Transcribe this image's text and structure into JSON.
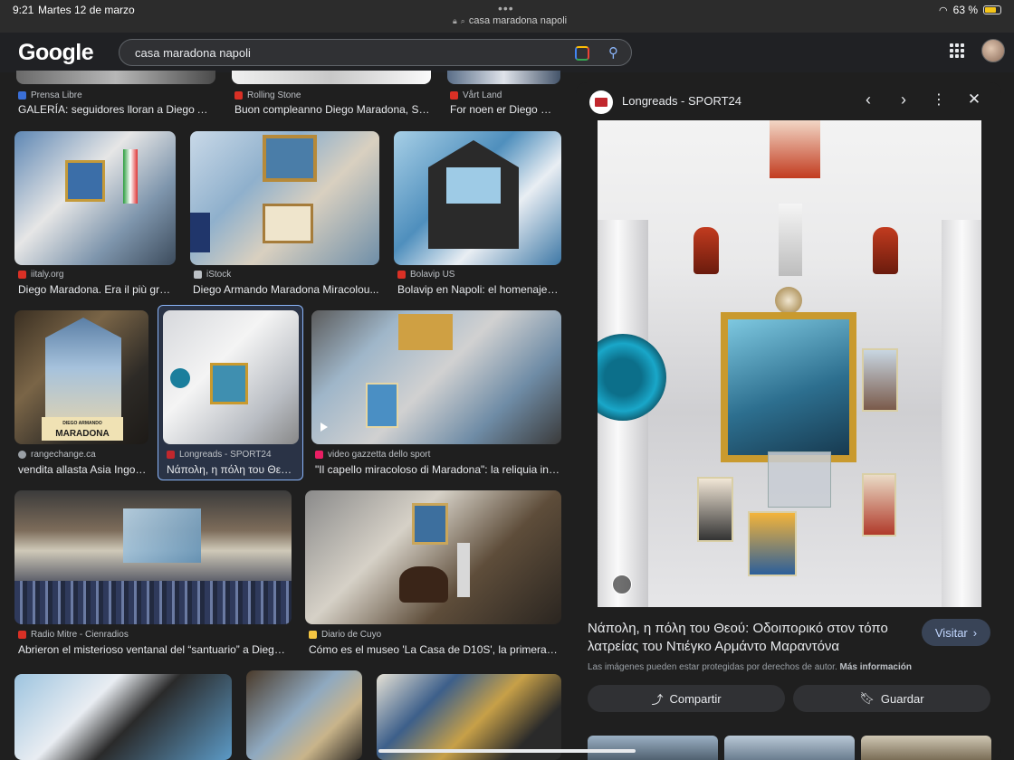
{
  "status_bar": {
    "time": "9:21",
    "date": "Martes 12 de marzo",
    "dots": "•••",
    "url": "casa maradona napoli",
    "battery": "63 %"
  },
  "header": {
    "logo": "Google",
    "search_value": "casa maradona napoli"
  },
  "results": [
    {
      "source": "Prensa Libre",
      "title": "GALERÍA: seguidores lloran a Diego Ar...",
      "fav_color": "#3a6fd8"
    },
    {
      "source": "Rolling Stone",
      "title": "Buon compleanno Diego Maradona, Sa...",
      "fav_color": "#d93025"
    },
    {
      "source": "Vårt Land",
      "title": "For noen er Diego M...",
      "fav_color": "#d93025"
    },
    {
      "source": "iitaly.org",
      "title": "Diego Maradona. Era il più gra...",
      "fav_color": "#d93025"
    },
    {
      "source": "iStock",
      "title": "Diego Armando Maradona Miracolou...",
      "fav_color": "#bdc1c6"
    },
    {
      "source": "Bolavip US",
      "title": "Bolavip en Napoli: el homenaje ...",
      "fav_color": "#d93025"
    },
    {
      "source": "rangechange.ca",
      "title": "vendita allasta Asia Ingor...",
      "fav_color": "#9aa0a6"
    },
    {
      "source": "Longreads - SPORT24",
      "title": "Νάπολη, η πόλη του Θεο...",
      "fav_color": "#c1272d"
    },
    {
      "source": "video gazzetta dello sport",
      "title": "\"Il capello miracoloso di Maradona\": la reliquia in ...",
      "fav_color": "#e91e63"
    },
    {
      "source": "Radio Mitre - Cienradios",
      "title": "Abrieron el misterioso ventanal del “santuario” a Diego ...",
      "fav_color": "#d93025"
    },
    {
      "source": "Diario de Cuyo",
      "title": "Cómo es el museo 'La Casa de D10S', la primera ca...",
      "fav_color": "#f4c542"
    }
  ],
  "panel": {
    "source": "Longreads - SPORT24",
    "title": "Νάπολη, η πόλη του Θεού: Οδοιπορικό στον τόπο λατρείας του Ντιέγκο Αρμάντο Μαραντόνα",
    "visit_label": "Visitar",
    "copyright": "Las imágenes pueden estar protegidas por derechos de autor.",
    "more_info": "Más información",
    "share_label": "Compartir",
    "save_label": "Guardar"
  },
  "thumbnail_overlays": {
    "maradona_sign": "MARADONA",
    "diego_armando": "DIEGO ARMANDO"
  }
}
